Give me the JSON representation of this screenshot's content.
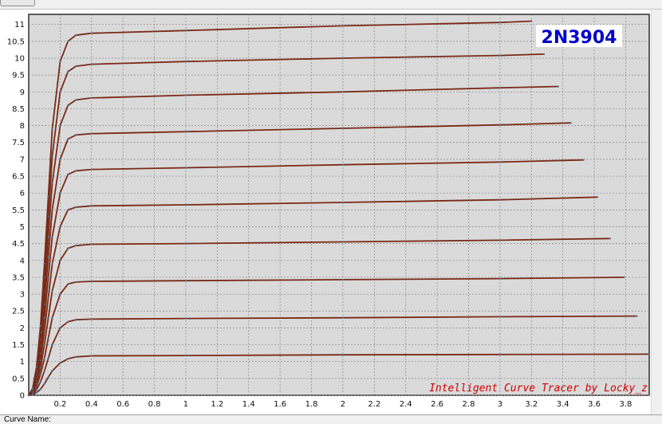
{
  "toolbar": {
    "button_label": ""
  },
  "status_bar": {
    "curve_name_label": "Curve Name:"
  },
  "chart_data": {
    "type": "line",
    "title": "2N3904",
    "watermark": "Intelligent Curve Tracer by Locky_z",
    "xlabel": "",
    "ylabel": "",
    "xlim": [
      0,
      3.95
    ],
    "ylim": [
      0,
      11.3
    ],
    "grid": true,
    "x_ticks": [
      "0.2",
      "0.4",
      "0.6",
      "0.8",
      "1",
      "1.2",
      "1.4",
      "1.6",
      "1.8",
      "2",
      "2.2",
      "2.4",
      "2.6",
      "2.8",
      "3",
      "3.2",
      "3.4",
      "3.6",
      "3.8"
    ],
    "y_ticks": [
      "0",
      "0.5",
      "1",
      "1.5",
      "2",
      "2.5",
      "3",
      "3.5",
      "4",
      "4.5",
      "5",
      "5.5",
      "6",
      "6.5",
      "7",
      "7.5",
      "8",
      "8.5",
      "9",
      "9.5",
      "10",
      "10.5",
      "11"
    ],
    "colors": {
      "plot_background": "#dadada",
      "grid": "#888888",
      "curve": "#7a2a16",
      "title": "#0000cc",
      "watermark": "#cc0000"
    },
    "series": [
      {
        "x": [
          0,
          0.025,
          0.05,
          0.075,
          0.1,
          0.125,
          0.15,
          0.2,
          0.25,
          0.3,
          0.4,
          1,
          2,
          3,
          3.95
        ],
        "y": [
          0,
          0.02,
          0.08,
          0.18,
          0.34,
          0.54,
          0.72,
          0.96,
          1.08,
          1.14,
          1.17,
          1.18,
          1.2,
          1.21,
          1.22
        ]
      },
      {
        "x": [
          0,
          0.025,
          0.05,
          0.075,
          0.1,
          0.125,
          0.15,
          0.2,
          0.25,
          0.3,
          0.4,
          1,
          2,
          3,
          3.87
        ],
        "y": [
          0,
          0.04,
          0.16,
          0.4,
          0.72,
          1.1,
          1.5,
          2.0,
          2.18,
          2.24,
          2.26,
          2.28,
          2.3,
          2.33,
          2.35
        ]
      },
      {
        "x": [
          0,
          0.025,
          0.05,
          0.075,
          0.1,
          0.125,
          0.15,
          0.2,
          0.25,
          0.3,
          0.4,
          1,
          2,
          3,
          3.79
        ],
        "y": [
          0,
          0.06,
          0.26,
          0.62,
          1.1,
          1.7,
          2.3,
          3.0,
          3.3,
          3.36,
          3.38,
          3.4,
          3.43,
          3.46,
          3.5
        ]
      },
      {
        "x": [
          0,
          0.025,
          0.05,
          0.075,
          0.1,
          0.125,
          0.15,
          0.2,
          0.25,
          0.3,
          0.4,
          1,
          2,
          3,
          3.7
        ],
        "y": [
          0,
          0.08,
          0.34,
          0.82,
          1.5,
          2.3,
          3.1,
          4.0,
          4.36,
          4.44,
          4.48,
          4.5,
          4.55,
          4.6,
          4.65
        ]
      },
      {
        "x": [
          0,
          0.025,
          0.05,
          0.075,
          0.1,
          0.125,
          0.15,
          0.2,
          0.25,
          0.3,
          0.4,
          1,
          2,
          3,
          3.62
        ],
        "y": [
          0,
          0.1,
          0.44,
          1.04,
          1.9,
          2.9,
          3.9,
          5.0,
          5.5,
          5.58,
          5.62,
          5.65,
          5.72,
          5.8,
          5.88
        ]
      },
      {
        "x": [
          0,
          0.025,
          0.05,
          0.075,
          0.1,
          0.125,
          0.15,
          0.2,
          0.25,
          0.3,
          0.4,
          1,
          2,
          3,
          3.53
        ],
        "y": [
          0,
          0.12,
          0.52,
          1.24,
          2.3,
          3.5,
          4.7,
          6.0,
          6.55,
          6.66,
          6.7,
          6.75,
          6.84,
          6.92,
          6.98
        ]
      },
      {
        "x": [
          0,
          0.025,
          0.05,
          0.075,
          0.1,
          0.125,
          0.15,
          0.2,
          0.25,
          0.3,
          0.4,
          1,
          2,
          3,
          3.45
        ],
        "y": [
          0,
          0.14,
          0.6,
          1.46,
          2.7,
          4.1,
          5.5,
          7.0,
          7.6,
          7.72,
          7.76,
          7.82,
          7.92,
          8.02,
          8.08
        ]
      },
      {
        "x": [
          0,
          0.025,
          0.05,
          0.075,
          0.1,
          0.125,
          0.15,
          0.2,
          0.25,
          0.3,
          0.4,
          1,
          2,
          3,
          3.37
        ],
        "y": [
          0,
          0.16,
          0.68,
          1.66,
          3.1,
          4.7,
          6.3,
          8.0,
          8.6,
          8.76,
          8.82,
          8.9,
          9.0,
          9.12,
          9.16
        ]
      },
      {
        "x": [
          0,
          0.025,
          0.05,
          0.075,
          0.1,
          0.125,
          0.15,
          0.2,
          0.25,
          0.3,
          0.4,
          1,
          2,
          3,
          3.28
        ],
        "y": [
          0,
          0.18,
          0.76,
          1.86,
          3.5,
          5.3,
          7.1,
          9.0,
          9.6,
          9.76,
          9.82,
          9.9,
          10.0,
          10.08,
          10.12
        ]
      },
      {
        "x": [
          0,
          0.025,
          0.05,
          0.075,
          0.1,
          0.125,
          0.15,
          0.2,
          0.25,
          0.3,
          0.4,
          1,
          2,
          3,
          3.2
        ],
        "y": [
          0,
          0.2,
          0.84,
          2.06,
          3.9,
          5.9,
          7.9,
          9.9,
          10.5,
          10.68,
          10.74,
          10.82,
          10.96,
          11.06,
          11.1
        ]
      }
    ]
  }
}
